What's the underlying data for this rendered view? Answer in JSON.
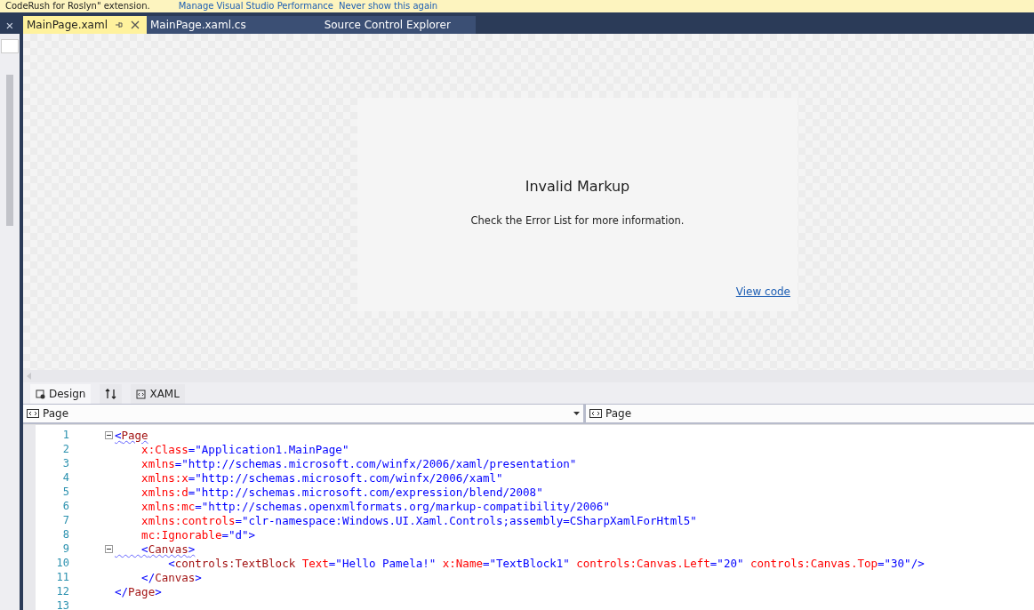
{
  "info_bar": {
    "message": "CodeRush for Roslyn\" extension.",
    "links": [
      "Manage Visual Studio Performance",
      "Never show this again"
    ]
  },
  "side_panel": {
    "close": "×"
  },
  "tabs": [
    {
      "label": "MainPage.xaml",
      "selected": true
    },
    {
      "label": "MainPage.xaml.cs",
      "selected": false
    },
    {
      "label": "Source Control Explorer",
      "selected": false
    }
  ],
  "designer": {
    "title": "Invalid Markup",
    "message": "Check the Error List for more information.",
    "link": "View code"
  },
  "view_tabs": [
    {
      "label": "Design",
      "kind": "design",
      "selected": true
    },
    {
      "kind": "swap",
      "selected": false
    },
    {
      "label": "XAML",
      "kind": "xaml",
      "selected": false
    }
  ],
  "dropdowns": [
    {
      "value": "Page",
      "caret": true
    },
    {
      "value": "Page",
      "caret": false
    }
  ],
  "code_lines": [
    {
      "number": "1",
      "fold": true,
      "tokens": [
        {
          "kind": "punct",
          "text": "<",
          "squiggle": true
        },
        {
          "kind": "tag",
          "text": "Page",
          "squiggle": true
        }
      ]
    },
    {
      "number": "2",
      "fold": false,
      "tokens": [
        {
          "kind": "attr",
          "text": "    x:Class"
        },
        {
          "kind": "punct",
          "text": "=\"Application1.MainPage\""
        }
      ]
    },
    {
      "number": "3",
      "fold": false,
      "tokens": [
        {
          "kind": "attr",
          "text": "    xmlns"
        },
        {
          "kind": "punct",
          "text": "=\"http://schemas.microsoft.com/winfx/2006/xaml/presentation\""
        }
      ]
    },
    {
      "number": "4",
      "fold": false,
      "tokens": [
        {
          "kind": "attr",
          "text": "    xmlns:x"
        },
        {
          "kind": "punct",
          "text": "=\"http://schemas.microsoft.com/winfx/2006/xaml\""
        }
      ]
    },
    {
      "number": "5",
      "fold": false,
      "tokens": [
        {
          "kind": "attr",
          "text": "    xmlns:d"
        },
        {
          "kind": "punct",
          "text": "=\"http://schemas.microsoft.com/expression/blend/2008\""
        }
      ]
    },
    {
      "number": "6",
      "fold": false,
      "tokens": [
        {
          "kind": "attr",
          "text": "    xmlns:mc"
        },
        {
          "kind": "punct",
          "text": "=\"http://schemas.openxmlformats.org/markup-compatibility/2006\""
        }
      ]
    },
    {
      "number": "7",
      "fold": false,
      "tokens": [
        {
          "kind": "attr",
          "text": "    xmlns:controls"
        },
        {
          "kind": "punct",
          "text": "=\"clr-namespace:Windows.UI.Xaml.Controls;assembly=CSharpXamlForHtml5\""
        }
      ]
    },
    {
      "number": "8",
      "fold": false,
      "tokens": [
        {
          "kind": "attr",
          "text": "    mc:Ignorable"
        },
        {
          "kind": "punct",
          "text": "=\"d\">"
        }
      ]
    },
    {
      "number": "9",
      "fold": true,
      "tokens": [
        {
          "kind": "punct",
          "text": "    <",
          "squiggle": true
        },
        {
          "kind": "tag",
          "text": "Canvas",
          "squiggle": true
        },
        {
          "kind": "punct",
          "text": ">",
          "squiggle": true
        }
      ]
    },
    {
      "number": "10",
      "fold": false,
      "tokens": [
        {
          "kind": "punct",
          "text": "        <"
        },
        {
          "kind": "tag",
          "text": "controls:TextBlock"
        },
        {
          "kind": "attr",
          "text": " Text"
        },
        {
          "kind": "punct",
          "text": "=\"Hello Pamela!\""
        },
        {
          "kind": "attr",
          "text": " x:Name"
        },
        {
          "kind": "punct",
          "text": "=\"TextBlock1\""
        },
        {
          "kind": "attr",
          "text": " controls:Canvas.Left"
        },
        {
          "kind": "punct",
          "text": "=\"20\""
        },
        {
          "kind": "attr",
          "text": " controls:Canvas.Top"
        },
        {
          "kind": "punct",
          "text": "=\"30\"/>"
        }
      ]
    },
    {
      "number": "11",
      "fold": false,
      "tokens": [
        {
          "kind": "punct",
          "text": "    </"
        },
        {
          "kind": "tag",
          "text": "Canvas"
        },
        {
          "kind": "punct",
          "text": ">"
        }
      ]
    },
    {
      "number": "12",
      "fold": false,
      "tokens": [
        {
          "kind": "punct",
          "text": "</"
        },
        {
          "kind": "tag",
          "text": "Page"
        },
        {
          "kind": "punct",
          "text": ">"
        }
      ]
    },
    {
      "number": "13",
      "fold": false
    }
  ]
}
